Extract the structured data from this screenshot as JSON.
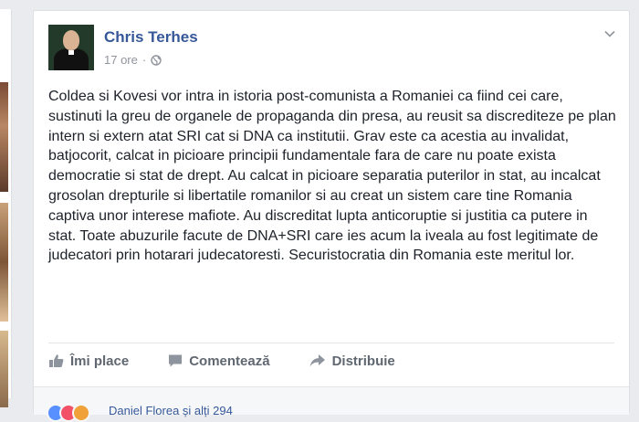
{
  "post": {
    "author": "Chris Terhes",
    "time": "17 ore",
    "separator": "·",
    "text": "Coldea si Kovesi vor intra in istoria post-comunista a Romaniei ca fiind cei care, sustinuti la greu de organele de propaganda din presa, au reusit sa discrediteze pe plan intern si extern atat SRI cat si DNA ca institutii. Grav este ca acestia au invalidat, batjocorit, calcat in picioare principii fundamentale fara de care nu poate exista democratie si stat de drept. Au calcat in picioare separatia puterilor in stat, au incalcat grosolan drepturile si libertatile romanilor si au creat un sistem care tine Romania captiva unor interese mafiote. Au discreditat lupta anticoruptie si justitia ca putere in stat. Toate abuzurile facute de DNA+SRI care ies acum la iveala au fost legitimate de judecatori prin hotarari judecatoresti. Securistocratia din Romania este meritul lor."
  },
  "actions": {
    "like": "Îmi place",
    "comment": "Comentează",
    "share": "Distribuie"
  },
  "reactions": {
    "summary": "Daniel Florea și alți 294"
  },
  "icons": {
    "privacy": "globe-icon",
    "menu": "chevron-down-icon",
    "like": "thumbs-up-icon",
    "comment": "comment-icon",
    "share": "share-arrow-icon"
  },
  "colors": {
    "link": "#365899",
    "text": "#1d2129",
    "muted": "#90949c",
    "action": "#606770"
  }
}
